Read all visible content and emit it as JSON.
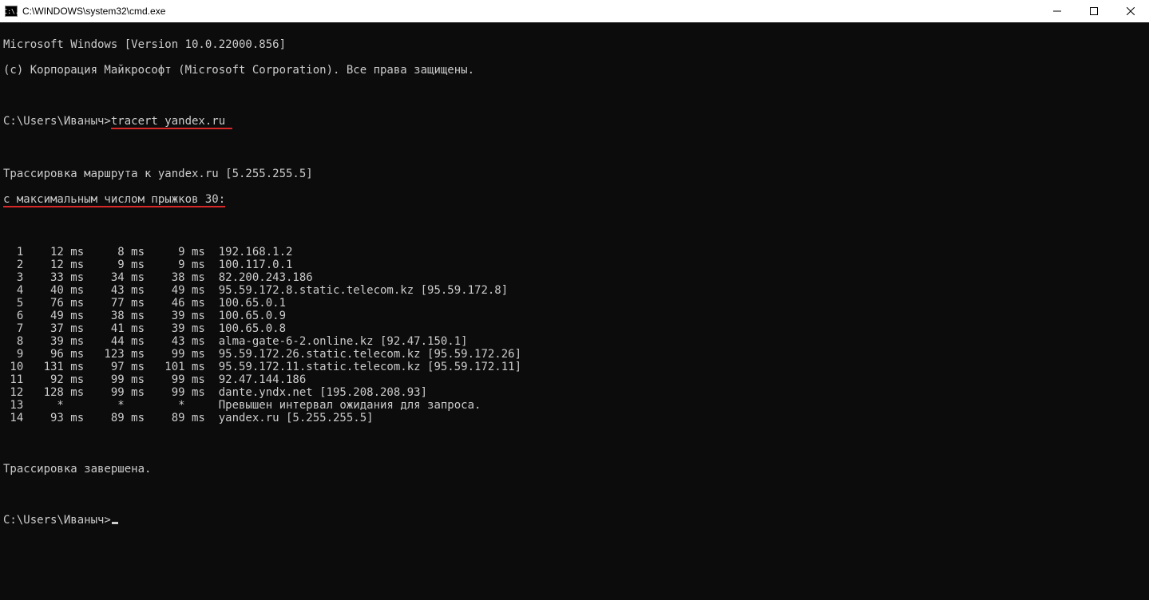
{
  "titlebar": {
    "title": "C:\\WINDOWS\\system32\\cmd.exe",
    "cmd_icon_label": "C:\\."
  },
  "terminal": {
    "line_version": "Microsoft Windows [Version 10.0.22000.856]",
    "line_copyright": "(c) Корпорация Майкрософт (Microsoft Corporation). Все права защищены.",
    "prompt1_prefix": "C:\\Users\\Иваныч>",
    "prompt1_command": "tracert yandex.ru ",
    "trace_header": "Трассировка маршрута к yandex.ru [5.255.255.5]",
    "max_hops": "с максимальным числом прыжков 30:",
    "hops": [
      {
        "n": "  1",
        "t1": "    12 ms",
        "t2": "     8 ms",
        "t3": "     9 ms",
        "host": "  192.168.1.2"
      },
      {
        "n": "  2",
        "t1": "    12 ms",
        "t2": "     9 ms",
        "t3": "     9 ms",
        "host": "  100.117.0.1"
      },
      {
        "n": "  3",
        "t1": "    33 ms",
        "t2": "    34 ms",
        "t3": "    38 ms",
        "host": "  82.200.243.186"
      },
      {
        "n": "  4",
        "t1": "    40 ms",
        "t2": "    43 ms",
        "t3": "    49 ms",
        "host": "  95.59.172.8.static.telecom.kz [95.59.172.8]"
      },
      {
        "n": "  5",
        "t1": "    76 ms",
        "t2": "    77 ms",
        "t3": "    46 ms",
        "host": "  100.65.0.1"
      },
      {
        "n": "  6",
        "t1": "    49 ms",
        "t2": "    38 ms",
        "t3": "    39 ms",
        "host": "  100.65.0.9"
      },
      {
        "n": "  7",
        "t1": "    37 ms",
        "t2": "    41 ms",
        "t3": "    39 ms",
        "host": "  100.65.0.8"
      },
      {
        "n": "  8",
        "t1": "    39 ms",
        "t2": "    44 ms",
        "t3": "    43 ms",
        "host": "  alma-gate-6-2.online.kz [92.47.150.1]"
      },
      {
        "n": "  9",
        "t1": "    96 ms",
        "t2": "   123 ms",
        "t3": "    99 ms",
        "host": "  95.59.172.26.static.telecom.kz [95.59.172.26]"
      },
      {
        "n": " 10",
        "t1": "   131 ms",
        "t2": "    97 ms",
        "t3": "   101 ms",
        "host": "  95.59.172.11.static.telecom.kz [95.59.172.11]"
      },
      {
        "n": " 11",
        "t1": "    92 ms",
        "t2": "    99 ms",
        "t3": "    99 ms",
        "host": "  92.47.144.186"
      },
      {
        "n": " 12",
        "t1": "   128 ms",
        "t2": "    99 ms",
        "t3": "    99 ms",
        "host": "  dante.yndx.net [195.208.208.93]"
      },
      {
        "n": " 13",
        "t1": "     *   ",
        "t2": "     *   ",
        "t3": "     *   ",
        "host": "  Превышен интервал ожидания для запроса."
      },
      {
        "n": " 14",
        "t1": "    93 ms",
        "t2": "    89 ms",
        "t3": "    89 ms",
        "host": "  yandex.ru [5.255.255.5]"
      }
    ],
    "trace_done": "Трассировка завершена.",
    "prompt2": "C:\\Users\\Иваныч>"
  }
}
